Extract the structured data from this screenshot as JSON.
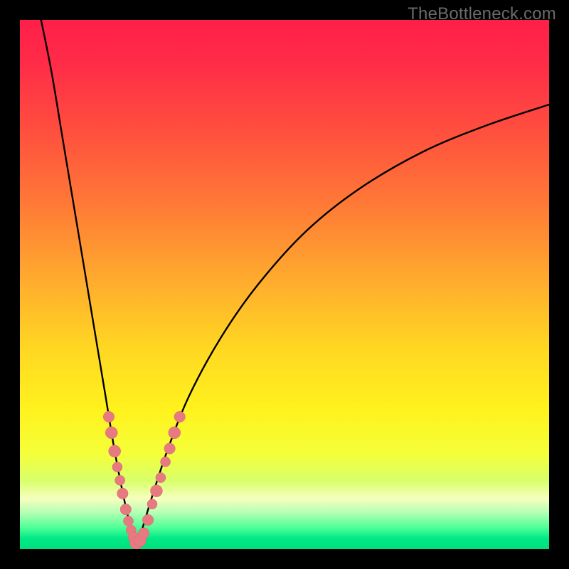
{
  "watermark": "TheBottleneck.com",
  "colors": {
    "gradient_stops": [
      {
        "offset": 0.0,
        "color": "#ff1f49"
      },
      {
        "offset": 0.08,
        "color": "#ff2b48"
      },
      {
        "offset": 0.2,
        "color": "#ff4c3f"
      },
      {
        "offset": 0.35,
        "color": "#ff7a36"
      },
      {
        "offset": 0.5,
        "color": "#ffae2d"
      },
      {
        "offset": 0.62,
        "color": "#ffd722"
      },
      {
        "offset": 0.74,
        "color": "#fff31e"
      },
      {
        "offset": 0.82,
        "color": "#f5ff3a"
      },
      {
        "offset": 0.87,
        "color": "#d8ff6a"
      },
      {
        "offset": 0.905,
        "color": "#f6ffc0"
      },
      {
        "offset": 0.93,
        "color": "#b7ffb4"
      },
      {
        "offset": 0.96,
        "color": "#4dff97"
      },
      {
        "offset": 0.98,
        "color": "#00e885"
      },
      {
        "offset": 1.0,
        "color": "#00e07f"
      }
    ],
    "curve": "#000000",
    "bead_fill": "#e77a80",
    "bead_stroke": "#d96a70"
  },
  "chart_data": {
    "type": "line",
    "title": "",
    "xlabel": "",
    "ylabel": "",
    "xlim": [
      0,
      100
    ],
    "ylim": [
      0,
      100
    ],
    "vertex_x": 22,
    "left_branch": [
      {
        "x": 4.0,
        "y": 100.0
      },
      {
        "x": 6.0,
        "y": 90.0
      },
      {
        "x": 8.0,
        "y": 78.0
      },
      {
        "x": 10.0,
        "y": 66.0
      },
      {
        "x": 12.0,
        "y": 54.0
      },
      {
        "x": 14.0,
        "y": 42.0
      },
      {
        "x": 16.0,
        "y": 30.0
      },
      {
        "x": 18.0,
        "y": 18.0
      },
      {
        "x": 20.0,
        "y": 8.0
      },
      {
        "x": 22.0,
        "y": 0.0
      }
    ],
    "right_branch": [
      {
        "x": 22.0,
        "y": 0.0
      },
      {
        "x": 25.0,
        "y": 10.0
      },
      {
        "x": 28.0,
        "y": 19.0
      },
      {
        "x": 32.0,
        "y": 29.0
      },
      {
        "x": 38.0,
        "y": 40.0
      },
      {
        "x": 45.0,
        "y": 50.0
      },
      {
        "x": 54.0,
        "y": 60.0
      },
      {
        "x": 64.0,
        "y": 68.0
      },
      {
        "x": 76.0,
        "y": 75.0
      },
      {
        "x": 88.0,
        "y": 80.0
      },
      {
        "x": 100.0,
        "y": 84.0
      }
    ],
    "beads": [
      {
        "x": 16.8,
        "y": 25.0,
        "r": 1.1
      },
      {
        "x": 17.3,
        "y": 22.0,
        "r": 1.2
      },
      {
        "x": 17.9,
        "y": 18.5,
        "r": 1.2
      },
      {
        "x": 18.4,
        "y": 15.5,
        "r": 1.0
      },
      {
        "x": 18.9,
        "y": 13.0,
        "r": 1.0
      },
      {
        "x": 19.4,
        "y": 10.5,
        "r": 1.1
      },
      {
        "x": 20.0,
        "y": 7.5,
        "r": 1.1
      },
      {
        "x": 20.5,
        "y": 5.3,
        "r": 1.0
      },
      {
        "x": 21.0,
        "y": 3.6,
        "r": 1.0
      },
      {
        "x": 21.5,
        "y": 2.2,
        "r": 1.1
      },
      {
        "x": 22.0,
        "y": 1.2,
        "r": 1.3
      },
      {
        "x": 22.7,
        "y": 1.6,
        "r": 1.2
      },
      {
        "x": 23.4,
        "y": 3.0,
        "r": 1.1
      },
      {
        "x": 24.2,
        "y": 5.5,
        "r": 1.1
      },
      {
        "x": 25.0,
        "y": 8.5,
        "r": 1.0
      },
      {
        "x": 25.8,
        "y": 11.0,
        "r": 1.2
      },
      {
        "x": 26.6,
        "y": 13.5,
        "r": 1.0
      },
      {
        "x": 27.5,
        "y": 16.5,
        "r": 1.0
      },
      {
        "x": 28.3,
        "y": 19.0,
        "r": 1.1
      },
      {
        "x": 29.2,
        "y": 22.0,
        "r": 1.2
      },
      {
        "x": 30.2,
        "y": 25.0,
        "r": 1.1
      }
    ]
  }
}
